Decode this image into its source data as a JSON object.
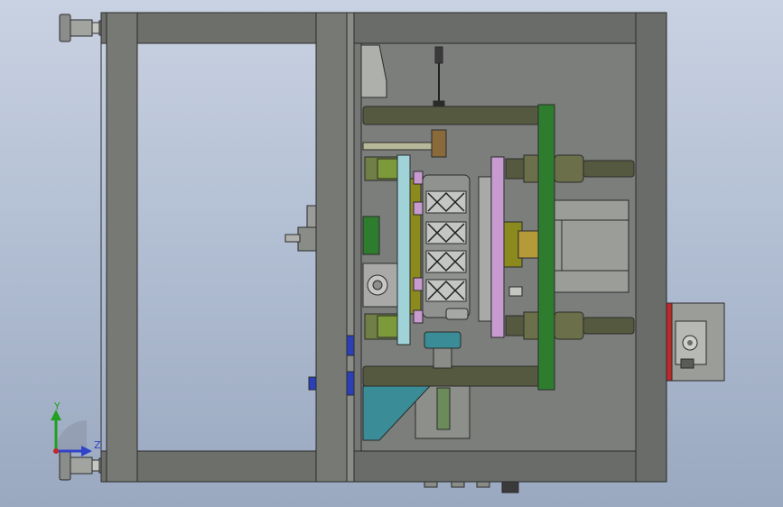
{
  "viewport": {
    "view_orientation": "front",
    "colors": {
      "background_top": "#c9d2e2",
      "background_bottom": "#9aa8c0",
      "frame": "#6d6f6b",
      "panel": "#7a7d7a",
      "rod": "#55593f",
      "green_plate": "#2e7d2e",
      "violet_plate": "#c79bcf",
      "olive_block": "#8a8a1e",
      "teal": "#3a8c96",
      "light_blue": "#9fd3d7",
      "blue_knob": "#2a3fb8",
      "red": "#c0282a"
    }
  },
  "triad": {
    "y_label": "Y",
    "z_label": "Z",
    "y_color": "#21a021",
    "z_color": "#2f42c8"
  }
}
